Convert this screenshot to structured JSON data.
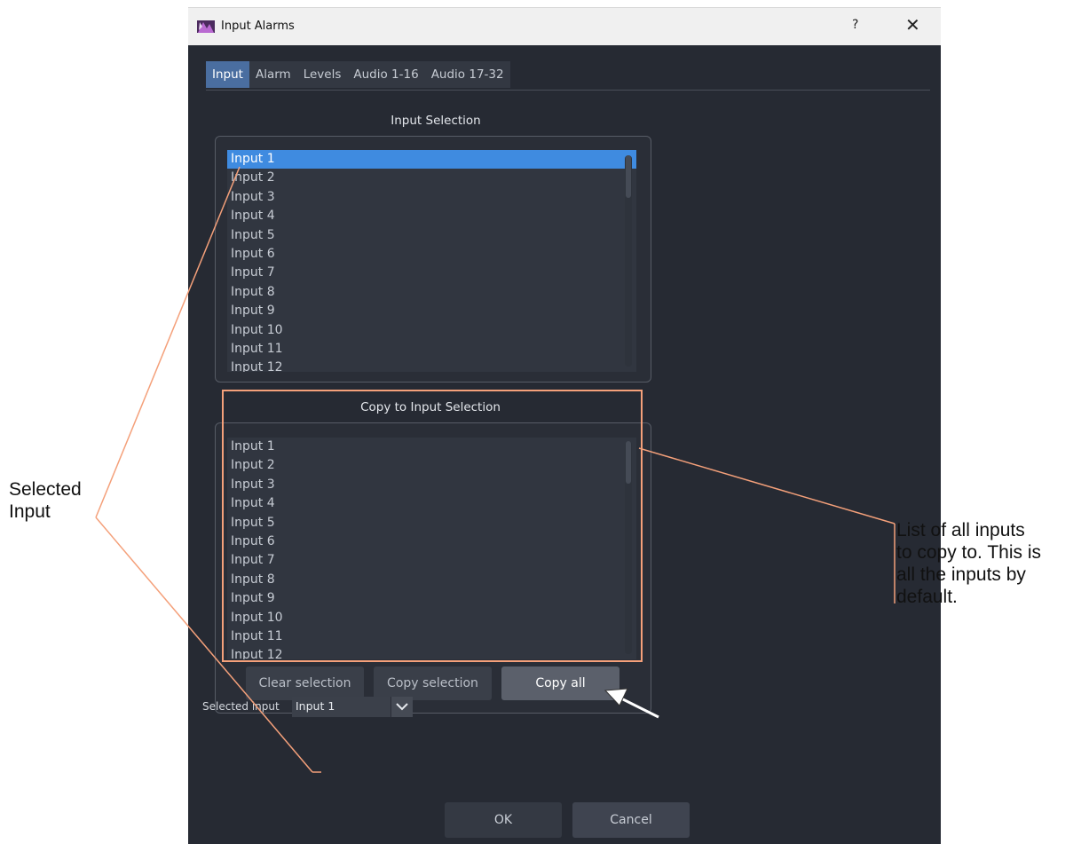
{
  "window": {
    "title": "Input Alarms",
    "help": "?",
    "close": "✕"
  },
  "tabs": [
    {
      "label": "Input",
      "active": true
    },
    {
      "label": "Alarm"
    },
    {
      "label": "Levels"
    },
    {
      "label": "Audio 1-16"
    },
    {
      "label": "Audio 17-32"
    }
  ],
  "input_selection": {
    "title": "Input Selection",
    "items": [
      "Input 1",
      "Input 2",
      "Input 3",
      "Input 4",
      "Input 5",
      "Input 6",
      "Input 7",
      "Input 8",
      "Input 9",
      "Input 10",
      "Input 11",
      "Input 12"
    ],
    "selected": "Input 1"
  },
  "copy_selection": {
    "title": "Copy to Input Selection",
    "items": [
      "Input 1",
      "Input 2",
      "Input 3",
      "Input 4",
      "Input 5",
      "Input 6",
      "Input 7",
      "Input 8",
      "Input 9",
      "Input 10",
      "Input 11",
      "Input 12"
    ],
    "buttons": {
      "clear": "Clear selection",
      "copy_selection": "Copy selection",
      "copy_all": "Copy all"
    }
  },
  "footer": {
    "selected_input_label": "Selected input",
    "selected_input_value": "Input 1",
    "ok": "OK",
    "cancel": "Cancel"
  },
  "annotations": {
    "left_callout": [
      "Selected",
      "Input"
    ],
    "right_callout": [
      "List of all inputs",
      "to copy to. This is",
      "all the inputs by",
      "default."
    ],
    "callout_color": "#f4a07a"
  },
  "colors": {
    "dialog_bg": "#262a33",
    "selection": "#3f8be0",
    "active_tab": "#4a6ea0"
  }
}
